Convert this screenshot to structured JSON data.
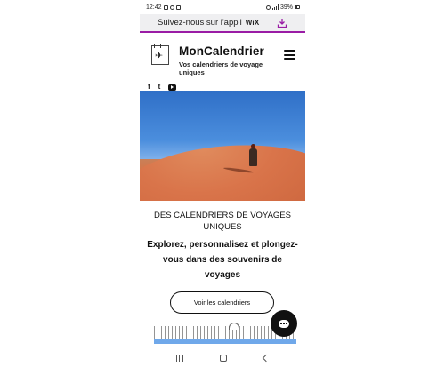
{
  "status_bar": {
    "time": "12:42",
    "battery": "39%",
    "icons": [
      "gallery-icon",
      "instagram-icon",
      "notification-icon",
      "wifi-icon",
      "signal-icon",
      "battery-icon"
    ]
  },
  "app_banner": {
    "text": "Suivez-nous sur l'appli",
    "brand": "WiX",
    "accent_color": "#9a1ca5",
    "icon": "download-icon"
  },
  "header": {
    "title": "MonCalendrier",
    "tagline": "Vos calendriers de voyage uniques",
    "logo_icon": "airplane-calendar-icon",
    "menu_icon": "hamburger-menu-icon",
    "social": [
      {
        "name": "facebook",
        "glyph": "f"
      },
      {
        "name": "twitter",
        "glyph": "t"
      },
      {
        "name": "youtube",
        "glyph": ""
      }
    ]
  },
  "hero": {
    "image": "person-walking-on-red-sand-dune"
  },
  "content": {
    "heading": "DES CALENDRIERS DE VOYAGES UNIQUES",
    "subheading": "Explorez, personnalisez et plongez-vous dans des souvenirs de voyages",
    "cta_label": "Voir les calendriers"
  },
  "chat": {
    "icon": "chat-bubble-icon"
  },
  "nav_bar": {
    "buttons": [
      "recents-icon",
      "home-icon",
      "back-icon"
    ]
  }
}
